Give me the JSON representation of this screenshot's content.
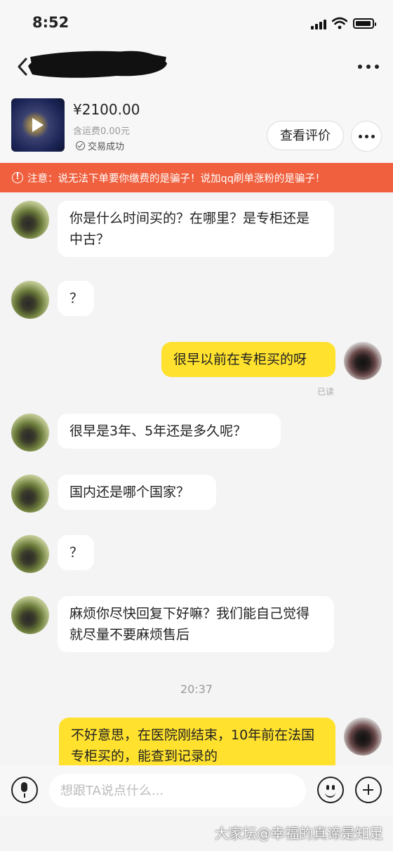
{
  "status_bar": {
    "time": "8:52"
  },
  "product": {
    "price": "¥2100.00",
    "shipping": "含运费0.00元",
    "status": "交易成功",
    "review_button": "查看评价"
  },
  "warning": {
    "text": "注意：说无法下单要你缴费的是骗子！说加qq刷单涨粉的是骗子！"
  },
  "messages": [
    {
      "from": "seller",
      "text": "你是什么时间买的？在哪里？是专柜还是中古？"
    },
    {
      "from": "seller",
      "text": "？"
    },
    {
      "from": "me",
      "text": "很早以前在专柜买的呀",
      "receipt": "已读"
    },
    {
      "from": "seller",
      "text": "很早是3年、5年还是多久呢？"
    },
    {
      "from": "seller",
      "text": "国内还是哪个国家？"
    },
    {
      "from": "seller",
      "text": "？"
    },
    {
      "from": "seller",
      "text": "麻烦你尽快回复下好嘛？我们能自己觉得就尽量不要麻烦售后"
    },
    {
      "from": "me",
      "text": "不好意思，在医院刚结束，10年前在法国专柜买的，能查到记录的"
    }
  ],
  "timestamp": "20:37",
  "input": {
    "placeholder": "想跟TA说点什么..."
  },
  "icons": [
    "back-icon",
    "more-icon",
    "play-icon",
    "check-circle-icon",
    "warning-icon",
    "mic-icon",
    "emoji-icon",
    "plus-icon",
    "signal-icon",
    "wifi-icon",
    "battery-icon"
  ],
  "colors": {
    "warning_bg": "#f0603e",
    "my_bubble": "#ffe12e",
    "their_bubble": "#ffffff",
    "background": "#f4f4f4"
  },
  "watermark": "大家坛@幸福的真谛是知足"
}
